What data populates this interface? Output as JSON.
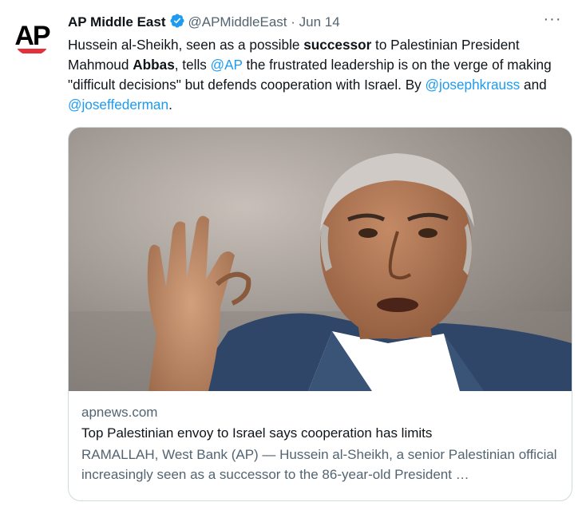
{
  "account": {
    "name": "AP Middle East",
    "handle": "@APMiddleEast",
    "separator": "·",
    "date": "Jun 14",
    "avatar_text": "AP",
    "more_label": "···"
  },
  "tweet": {
    "t1": "Hussein al-Sheikh, seen as a possible ",
    "bold1": "successor",
    "t2": " to Palestinian President Mahmoud ",
    "bold2": "Abbas",
    "t3": ", tells ",
    "mention_ap": "@AP",
    "t4": " the frustrated leadership is on the verge of making \"difficult decisions\" but defends cooperation with Israel. By ",
    "mention_1": "@josephkrauss",
    "t5": " and ",
    "mention_2": "@joseffederman",
    "t6": "."
  },
  "card": {
    "domain": "apnews.com",
    "headline": "Top Palestinian envoy to Israel says cooperation has limits",
    "description": "RAMALLAH, West Bank (AP) — Hussein al-Sheikh, a senior Palestinian official increasingly seen as a successor to the 86-year-old President …"
  },
  "colors": {
    "link": "#1d9bf0",
    "secondary": "#536471",
    "border": "#cfd9de",
    "verified": "#1d9bf0",
    "ap_red": "#e0313c"
  }
}
